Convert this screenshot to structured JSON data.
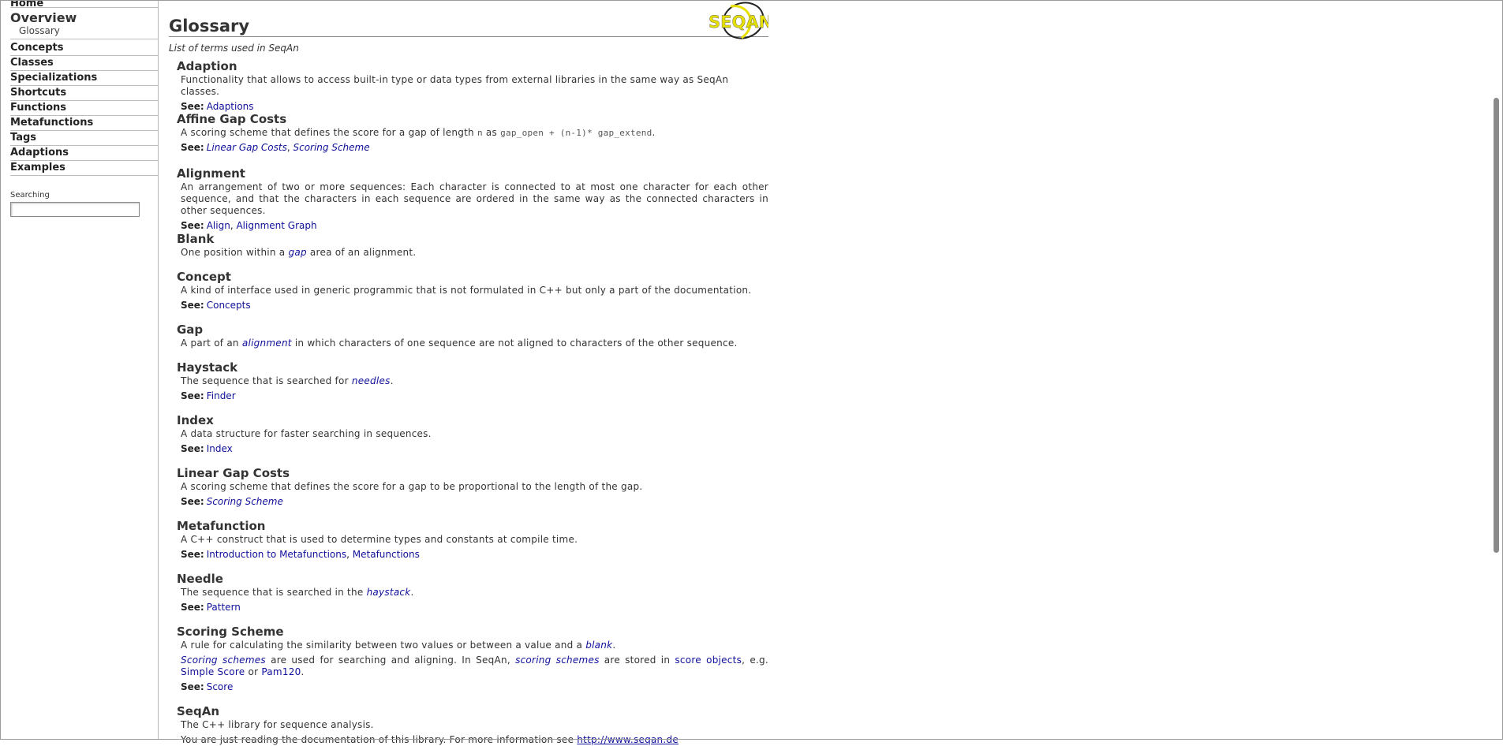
{
  "sidebar": {
    "home": "Home",
    "overview": "Overview",
    "glossary": "Glossary",
    "items": [
      "Concepts",
      "Classes",
      "Specializations",
      "Shortcuts",
      "Functions",
      "Metafunctions",
      "Tags",
      "Adaptions",
      "Examples"
    ],
    "search_label": "Searching",
    "search_value": ""
  },
  "page": {
    "title": "Glossary",
    "subtitle": "List of terms used in SeqAn",
    "logo_text": "SEQAN"
  },
  "see_label": "See:",
  "entries": {
    "adaption": {
      "term": "Adaption",
      "desc": "Functionality that allows to access built-in type or data types from external libraries in the same way as SeqAn classes.",
      "see": [
        "Adaptions"
      ]
    },
    "affine": {
      "term": "Affine Gap Costs",
      "desc_a": "A scoring scheme that defines the score for a gap of length",
      "code_n": "n",
      "desc_b": "as",
      "code_formula": "gap_open + (n-1)* gap_extend",
      "desc_end": ".",
      "see": [
        "Linear Gap Costs",
        "Scoring Scheme"
      ]
    },
    "alignment": {
      "term": "Alignment",
      "desc": "An arrangement of two or more sequences: Each character is connected to at most one character for each other sequence, and that the characters in each sequence are ordered in the same way as the connected characters in other sequences.",
      "see": [
        "Align",
        "Alignment Graph"
      ]
    },
    "blank": {
      "term": "Blank",
      "desc_a": "One position within a",
      "link": "gap",
      "desc_b": "area of an alignment."
    },
    "concept": {
      "term": "Concept",
      "desc": "A kind of interface used in generic programmic that is not formulated in C++ but only a part of the documentation.",
      "see": [
        "Concepts"
      ]
    },
    "gap": {
      "term": "Gap",
      "desc_a": "A part of an",
      "link": "alignment",
      "desc_b": "in which characters of one sequence are not aligned to characters of the other sequence."
    },
    "haystack": {
      "term": "Haystack",
      "desc_a": "The sequence that is searched for",
      "link": "needles",
      "desc_b": ".",
      "see": [
        "Finder"
      ]
    },
    "index": {
      "term": "Index",
      "desc": "A data structure for faster searching in sequences.",
      "see": [
        "Index"
      ]
    },
    "linear": {
      "term": "Linear Gap Costs",
      "desc": "A scoring scheme that defines the score for a gap to be proportional to the length of the gap.",
      "see": [
        "Scoring Scheme"
      ]
    },
    "metafunction": {
      "term": "Metafunction",
      "desc": "A C++ construct that is used to determine types and constants at compile time.",
      "see": [
        "Introduction to Metafunctions",
        "Metafunctions"
      ]
    },
    "needle": {
      "term": "Needle",
      "desc_a": "The sequence that is searched in the",
      "link": "haystack",
      "desc_b": ".",
      "see": [
        "Pattern"
      ]
    },
    "scoring": {
      "term": "Scoring Scheme",
      "desc_a": "A rule for calculating the similarity between two values or between a value and a",
      "link": "blank",
      "desc_b": ".",
      "p2_link1": "Scoring schemes",
      "p2_t1": "are used for searching and aligning. In SeqAn,",
      "p2_link2": "scoring schemes",
      "p2_t2": "are stored in",
      "p2_link3": "score objects",
      "p2_t3": ", e.g.",
      "p2_link4": "Simple Score",
      "p2_t4": "or",
      "p2_link5": "Pam120",
      "p2_t5": ".",
      "see": [
        "Score"
      ]
    },
    "seqan": {
      "term": "SeqAn",
      "desc": "The C++ library for sequence analysis.",
      "desc2_a": "You are just reading the documentation of this library. For more information see",
      "desc2_link": "http://www.seqan.de"
    }
  }
}
